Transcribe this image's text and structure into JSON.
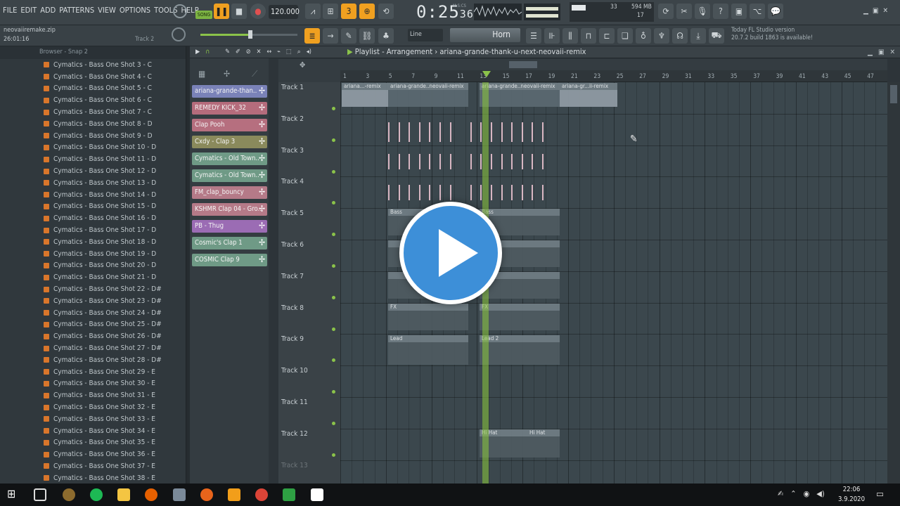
{
  "menu": [
    "FILE",
    "EDIT",
    "ADD",
    "PATTERNS",
    "VIEW",
    "OPTIONS",
    "TOOLS",
    "HELP"
  ],
  "transport": {
    "mode": "SONG",
    "tempo": "120.000",
    "time": "0:25",
    "time_ms": "36",
    "time_unit": "M:S:CS"
  },
  "stats": {
    "cpu": "33",
    "mem": "594 MB",
    "poly": "17"
  },
  "snap": "Line",
  "preset": "Horn",
  "hint": {
    "line1": "Today  FL Studio version",
    "line2": "20.7.2 build 1863 is available!"
  },
  "project": {
    "file": "neovaiiremake.zip",
    "time": "26:01:16",
    "track": "Track 2"
  },
  "browser": {
    "header": "Browser - Snap 2",
    "items": [
      "Cymatics - Bass One Shot 3 - C",
      "Cymatics - Bass One Shot 4 - C",
      "Cymatics - Bass One Shot 5 - C",
      "Cymatics - Bass One Shot 6 - C",
      "Cymatics - Bass One Shot 7 - C",
      "Cymatics - Bass One Shot 8 - D",
      "Cymatics - Bass One Shot 9 - D",
      "Cymatics - Bass One Shot 10 - D",
      "Cymatics - Bass One Shot 11 - D",
      "Cymatics - Bass One Shot 12 - D",
      "Cymatics - Bass One Shot 13 - D",
      "Cymatics - Bass One Shot 14 - D",
      "Cymatics - Bass One Shot 15 - D",
      "Cymatics - Bass One Shot 16 - D",
      "Cymatics - Bass One Shot 17 - D",
      "Cymatics - Bass One Shot 18 - D",
      "Cymatics - Bass One Shot 19 - D",
      "Cymatics - Bass One Shot 20 - D",
      "Cymatics - Bass One Shot 21 - D",
      "Cymatics - Bass One Shot 22 - D#",
      "Cymatics - Bass One Shot 23 - D#",
      "Cymatics - Bass One Shot 24 - D#",
      "Cymatics - Bass One Shot 25 - D#",
      "Cymatics - Bass One Shot 26 - D#",
      "Cymatics - Bass One Shot 27 - D#",
      "Cymatics - Bass One Shot 28 - D#",
      "Cymatics - Bass One Shot 29 - E",
      "Cymatics - Bass One Shot 30 - E",
      "Cymatics - Bass One Shot 31 - E",
      "Cymatics - Bass One Shot 32 - E",
      "Cymatics - Bass One Shot 33 - E",
      "Cymatics - Bass One Shot 34 - E",
      "Cymatics - Bass One Shot 35 - E",
      "Cymatics - Bass One Shot 36 - E",
      "Cymatics - Bass One Shot 37 - E",
      "Cymatics - Bass One Shot 38 - E"
    ]
  },
  "channels": [
    {
      "name": "ariana-grande-than..",
      "color": "#7a82b8"
    },
    {
      "name": "REMEDY KICK_32",
      "color": "#b56c7c"
    },
    {
      "name": "Clap Pooh",
      "color": "#b66f7f"
    },
    {
      "name": "Cxdy - Clap 3",
      "color": "#8a8a5c"
    },
    {
      "name": "Cymatics - Old Town..",
      "color": "#6f9a86"
    },
    {
      "name": "Cymatics - Old Town..",
      "color": "#6f9a86"
    },
    {
      "name": "FM_clap_bouncy",
      "color": "#b57a88"
    },
    {
      "name": "KSHMR Clap 04 - Gro..",
      "color": "#b57a88"
    },
    {
      "name": "PB - Thug",
      "color": "#9b6cb4"
    },
    {
      "name": "Cosmic's Clap 1",
      "color": "#6f9a86"
    },
    {
      "name": "COSMIC Clap 9",
      "color": "#6f9a86"
    }
  ],
  "playlist": {
    "title": "Playlist - Arrangement",
    "pattern": "ariana-grande-thank-u-next-neovaii-remix"
  },
  "tracks": [
    "Track 1",
    "Track 2",
    "Track 3",
    "Track 4",
    "Track 5",
    "Track 6",
    "Track 7",
    "Track 8",
    "Track 9",
    "Track 10",
    "Track 11",
    "Track 12",
    "Track 13"
  ],
  "ruler": [
    "1",
    "3",
    "5",
    "7",
    "9",
    "11",
    "13",
    "15",
    "17",
    "19",
    "21",
    "23",
    "25",
    "27",
    "29",
    "31",
    "33",
    "35",
    "37",
    "39",
    "41",
    "43",
    "45",
    "47"
  ],
  "clips": {
    "audio": "ariana...-remix",
    "audio2": "ariana-grande..neovaii-remix",
    "audio3": "ariana-gr...ii-remix",
    "bass": "Bass",
    "fx": "FX",
    "lead": "Lead",
    "lead2": "Lead 2",
    "hat": "Hi Hat"
  },
  "clock": {
    "time": "22:06",
    "date": "3.9.2020"
  }
}
